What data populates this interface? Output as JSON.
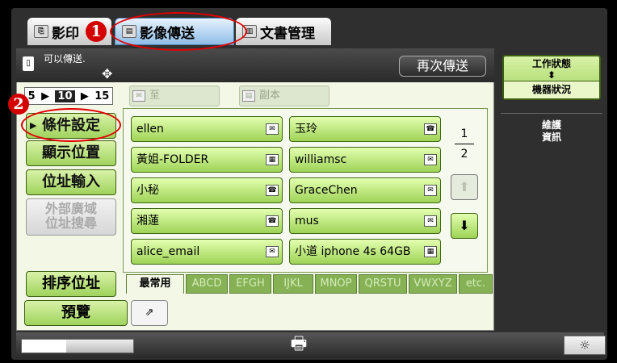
{
  "tabs": [
    {
      "label": "影印",
      "icon": "copy-icon"
    },
    {
      "label": "影像傳送",
      "icon": "image-send-icon"
    },
    {
      "label": "文書管理",
      "icon": "document-filing-icon"
    }
  ],
  "annotations": {
    "marker1": "1",
    "marker2": "2"
  },
  "status": {
    "text": "可以傳送."
  },
  "buttons": {
    "resend": "再次傳送"
  },
  "page_selector": {
    "options": [
      "5",
      "10",
      "15"
    ],
    "selected": "10"
  },
  "sidebar": {
    "condition_settings": "條件設定",
    "display_position": "顯示位置",
    "address_input": "位址輸入",
    "global_search_line1": "外部廣域",
    "global_search_line2": "位址搜尋",
    "sort_address": "排序位址",
    "preview": "預覽"
  },
  "destinations": {
    "to": "至",
    "cc": "副本"
  },
  "addresses": [
    {
      "name": "ellen",
      "type": "email-icon"
    },
    {
      "name": "玉玲",
      "type": "fax-icon"
    },
    {
      "name": "黃姐-FOLDER",
      "type": "folder-icon"
    },
    {
      "name": "williamsc",
      "type": "email-icon"
    },
    {
      "name": "小秘",
      "type": "fax-icon"
    },
    {
      "name": "GraceChen",
      "type": "email-icon"
    },
    {
      "name": "湘蓮",
      "type": "fax-icon"
    },
    {
      "name": "mus",
      "type": "email-icon"
    },
    {
      "name": "alice_email",
      "type": "email-icon"
    },
    {
      "name": "小道 iphone 4s 64GB",
      "type": "folder-icon"
    }
  ],
  "pager": {
    "current": "1",
    "total": "2"
  },
  "index_tabs": [
    "最常用",
    "ABCD",
    "EFGH",
    "IJKL",
    "MNOP",
    "QRSTU",
    "VWXYZ",
    "etc."
  ],
  "right_panel": {
    "job_status_line1": "工作狀態",
    "device_status": "機器狀況",
    "maintenance_line1": "維護",
    "maintenance_line2": "資訊"
  },
  "colors": {
    "accent_green": "#9fd35d",
    "annotation_red": "#e10000",
    "active_tab_blue": "#8fbde6"
  }
}
